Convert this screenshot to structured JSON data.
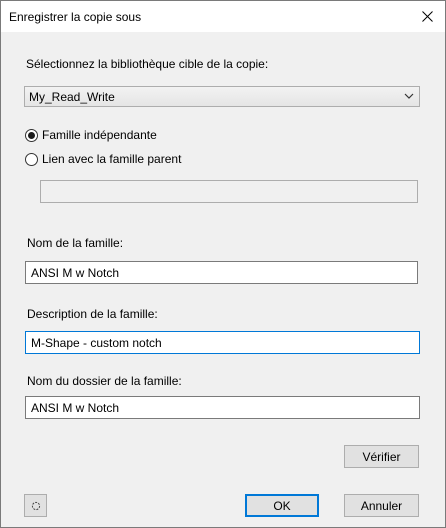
{
  "window": {
    "title": "Enregistrer la copie sous"
  },
  "library": {
    "label": "Sélectionnez la bibliothèque cible de la copie:",
    "selected": "My_Read_Write"
  },
  "options": {
    "independent_label": "Famille indépendante",
    "independent_checked": true,
    "parent_link_label": "Lien avec la famille parent",
    "parent_link_checked": false,
    "parent_field_value": ""
  },
  "family": {
    "name_label": "Nom de la famille:",
    "name_value": "ANSI M w Notch",
    "description_label": "Description de la famille:",
    "description_value": "M-Shape - custom notch",
    "folder_label": "Nom du dossier de la famille:",
    "folder_value": "ANSI M w Notch"
  },
  "buttons": {
    "verify": "Vérifier",
    "ok": "OK",
    "cancel": "Annuler"
  },
  "icons": {
    "close": "close-icon",
    "dropdown": "chevron-down-icon",
    "help": "help-icon"
  }
}
